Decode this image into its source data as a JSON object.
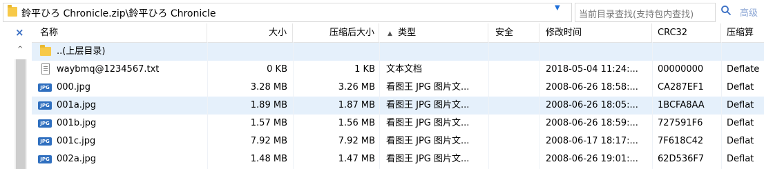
{
  "address": {
    "path": "鈴平ひろ Chronicle.zip\\鈴平ひろ Chronicle",
    "dropdown_glyph": "▼"
  },
  "search": {
    "placeholder": "当前目录查找(支持包内查找)"
  },
  "advanced_label": "高级",
  "left": {
    "close_glyph": "×",
    "scroll_up_glyph": "^"
  },
  "columns": {
    "name": "名称",
    "size": "大小",
    "packed": "压缩后大小",
    "type": "类型",
    "type_sort": "▲",
    "security": "安全",
    "modified": "修改时间",
    "crc": "CRC32",
    "method": "压缩算"
  },
  "rows": [
    {
      "icon": "folder-icon",
      "name": "..(上层目录)",
      "size": "",
      "packed": "",
      "type": "",
      "modified": "",
      "crc": "",
      "method": ""
    },
    {
      "icon": "text-file-icon",
      "name": "waybmq@1234567.txt",
      "size": "0 KB",
      "packed": "1 KB",
      "type": "文本文档",
      "modified": "2018-05-04 11:24:...",
      "crc": "00000000",
      "method": "Deflate"
    },
    {
      "icon": "jpg-file-icon",
      "icon_text": "JPG",
      "name": "000.jpg",
      "size": "3.28 MB",
      "packed": "3.26 MB",
      "type": "看图王 JPG 图片文...",
      "modified": "2008-06-26 18:58:...",
      "crc": "CA287EF1",
      "method": "Deflat"
    },
    {
      "icon": "jpg-file-icon",
      "icon_text": "JPG",
      "name": "001a.jpg",
      "size": "1.89 MB",
      "packed": "1.87 MB",
      "type": "看图王 JPG 图片文...",
      "modified": "2008-06-26 18:05:...",
      "crc": "1BCFA8AA",
      "method": "Deflat"
    },
    {
      "icon": "jpg-file-icon",
      "icon_text": "JPG",
      "name": "001b.jpg",
      "size": "1.57 MB",
      "packed": "1.56 MB",
      "type": "看图王 JPG 图片文...",
      "modified": "2008-06-26 18:59:...",
      "crc": "727591F6",
      "method": "Deflat"
    },
    {
      "icon": "jpg-file-icon",
      "icon_text": "JPG",
      "name": "001c.jpg",
      "size": "7.92 MB",
      "packed": "7.92 MB",
      "type": "看图王 JPG 图片文...",
      "modified": "2008-06-17 18:17:...",
      "crc": "7F618C42",
      "method": "Deflat"
    },
    {
      "icon": "jpg-file-icon",
      "icon_text": "JPG",
      "name": "002a.jpg",
      "size": "1.48 MB",
      "packed": "1.47 MB",
      "type": "看图王 JPG 图片文...",
      "modified": "2008-06-26 19:01:...",
      "crc": "62D536F7",
      "method": "Deflat"
    }
  ],
  "selected_rows": [
    0,
    3
  ],
  "colors": {
    "selection": "#e5f0fb",
    "accent": "#1e6fd9",
    "folder": "#f7c948",
    "jpg_badge": "#2f6fbf"
  }
}
